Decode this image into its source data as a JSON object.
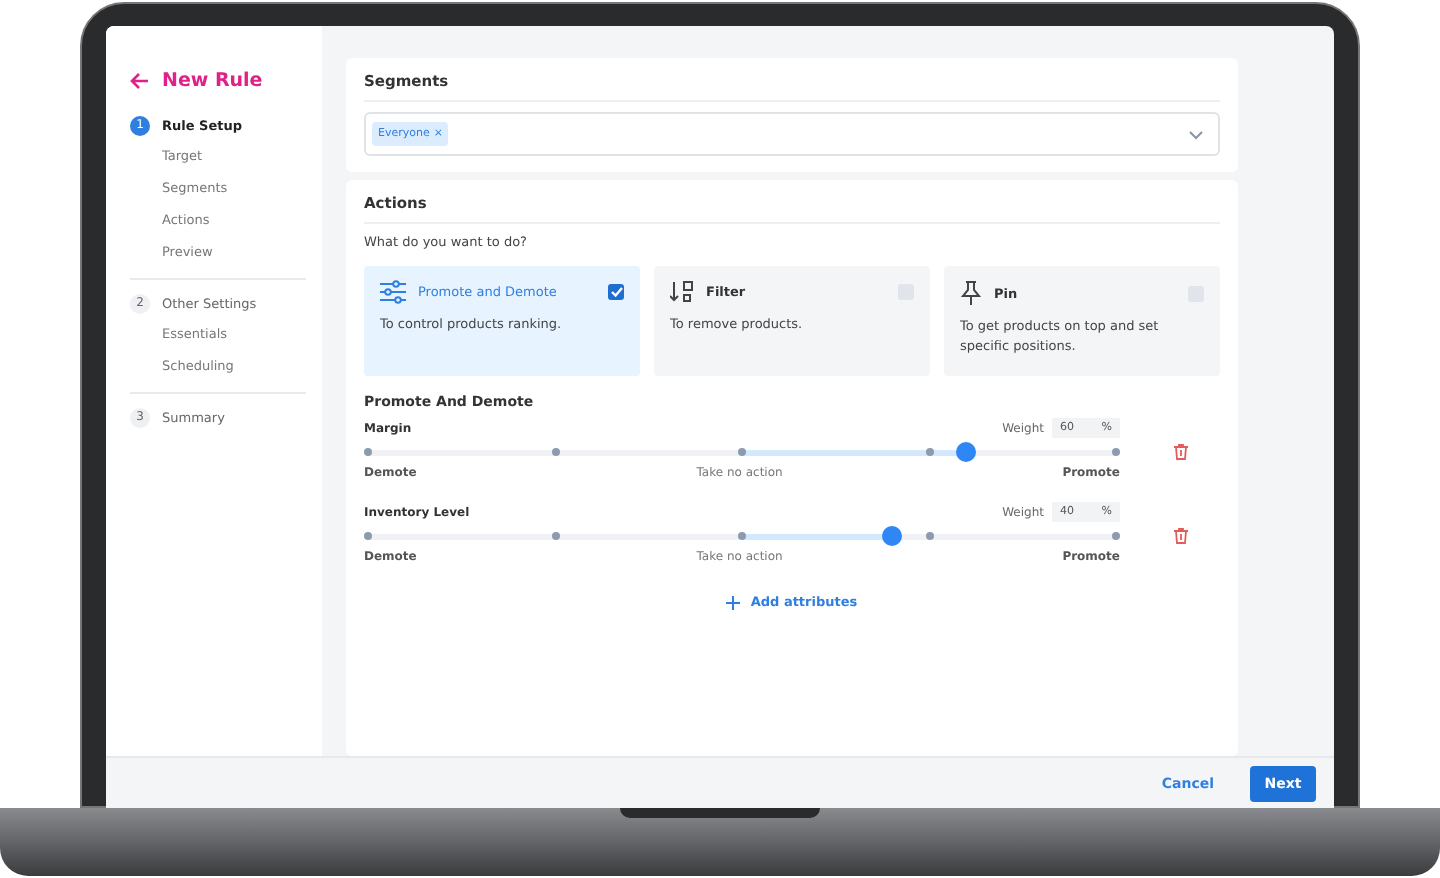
{
  "sidebar": {
    "title": "New Rule",
    "steps": [
      {
        "number": "1",
        "label": "Rule Setup",
        "selected": true,
        "substeps": [
          "Target",
          "Segments",
          "Actions",
          "Preview"
        ]
      },
      {
        "number": "2",
        "label": "Other Settings",
        "selected": false,
        "substeps": [
          "Essentials",
          "Scheduling"
        ]
      },
      {
        "number": "3",
        "label": "Summary",
        "selected": false
      }
    ]
  },
  "segments": {
    "title": "Segments",
    "tags": [
      {
        "label": "Everyone",
        "remove": "×"
      }
    ]
  },
  "actions": {
    "title": "Actions",
    "question": "What do you want to do?",
    "options": [
      {
        "kind": "promote",
        "title": "Promote and Demote",
        "description": "To control products ranking.",
        "selected": true
      },
      {
        "kind": "filter",
        "title": "Filter",
        "description": "To remove products.",
        "selected": false
      },
      {
        "kind": "pin",
        "title": "Pin",
        "description": "To get products on top and set specific positions.",
        "selected": false
      }
    ]
  },
  "promote": {
    "title": "Promote And Demote",
    "attributes": [
      {
        "name": "Margin",
        "weight_label": "Weight",
        "weight": "60",
        "unit": "%",
        "level": 0.8,
        "left": "Demote",
        "center": "Take no action",
        "right": "Promote"
      },
      {
        "name": "Inventory Level",
        "weight_label": "Weight",
        "weight": "40",
        "unit": "%",
        "level": 0.7,
        "left": "Demote",
        "center": "Take no action",
        "right": "Promote"
      }
    ],
    "add_label": "Add attributes"
  },
  "footer": {
    "cancel": "Cancel",
    "next": "Next"
  }
}
